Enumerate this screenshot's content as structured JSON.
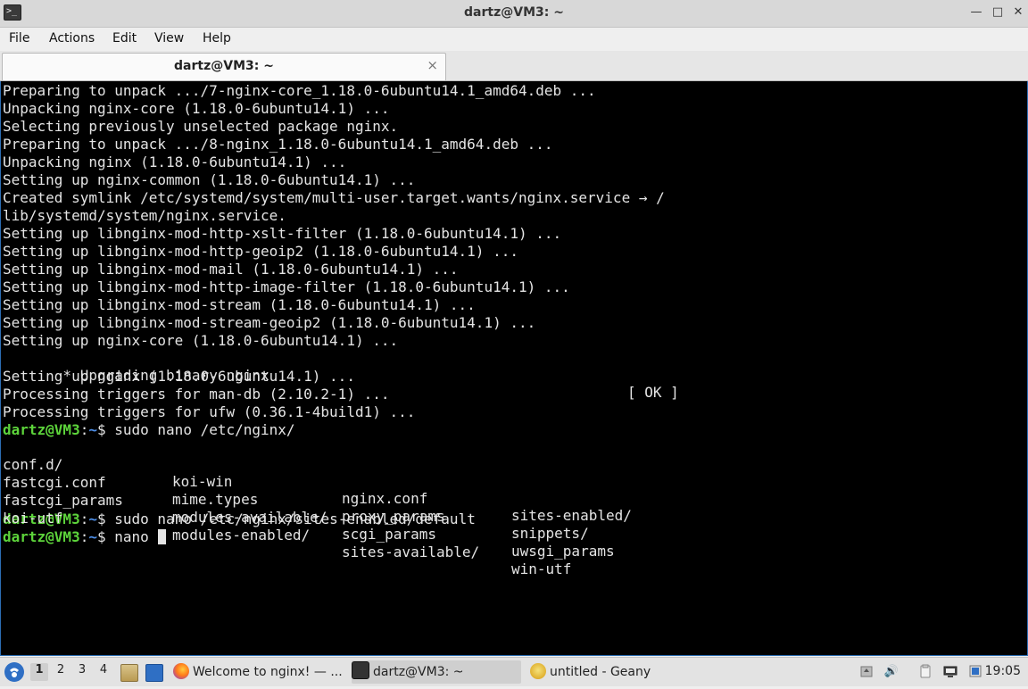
{
  "window": {
    "title": "dartz@VM3: ~",
    "terminal_glyph": ">_",
    "controls": {
      "minimize": "—",
      "maximize": "□",
      "close": "✕"
    }
  },
  "menubar": {
    "items": [
      "File",
      "Actions",
      "Edit",
      "View",
      "Help"
    ]
  },
  "tabs": [
    {
      "label": "dartz@VM3: ~",
      "close": "×"
    }
  ],
  "terminal": {
    "output_lines": [
      "Preparing to unpack .../7-nginx-core_1.18.0-6ubuntu14.1_amd64.deb ...",
      "Unpacking nginx-core (1.18.0-6ubuntu14.1) ...",
      "Selecting previously unselected package nginx.",
      "Preparing to unpack .../8-nginx_1.18.0-6ubuntu14.1_amd64.deb ...",
      "Unpacking nginx (1.18.0-6ubuntu14.1) ...",
      "Setting up nginx-common (1.18.0-6ubuntu14.1) ...",
      "Created symlink /etc/systemd/system/multi-user.target.wants/nginx.service → /",
      "lib/systemd/system/nginx.service.",
      "Setting up libnginx-mod-http-xslt-filter (1.18.0-6ubuntu14.1) ...",
      "Setting up libnginx-mod-http-geoip2 (1.18.0-6ubuntu14.1) ...",
      "Setting up libnginx-mod-mail (1.18.0-6ubuntu14.1) ...",
      "Setting up libnginx-mod-http-image-filter (1.18.0-6ubuntu14.1) ...",
      "Setting up libnginx-mod-stream (1.18.0-6ubuntu14.1) ...",
      "Setting up libnginx-mod-stream-geoip2 (1.18.0-6ubuntu14.1) ...",
      "Setting up nginx-core (1.18.0-6ubuntu14.1) ..."
    ],
    "upgrading_line": " * Upgrading binary nginx",
    "upgrading_status": "[ OK ]",
    "after_lines": [
      "Setting up nginx (1.18.0-6ubuntu14.1) ...",
      "Processing triggers for man-db (2.10.2-1) ...",
      "Processing triggers for ufw (0.36.1-4build1) ..."
    ],
    "prompt_user": "dartz@VM3",
    "prompt_sep": ":",
    "prompt_path": "~",
    "prompt_end": "$ ",
    "commands": [
      "sudo nano /etc/nginx/",
      "sudo nano /etc/nginx/sites-enabled/default",
      "nano "
    ],
    "completion_rows": [
      [
        "conf.d/",
        "koi-win",
        "nginx.conf",
        "sites-enabled/"
      ],
      [
        "fastcgi.conf",
        "mime.types",
        "proxy_params",
        "snippets/"
      ],
      [
        "fastcgi_params",
        "modules-available/",
        "scgi_params",
        "uwsgi_params"
      ],
      [
        "koi-utf",
        "modules-enabled/",
        "sites-available/",
        "win-utf"
      ]
    ]
  },
  "taskbar": {
    "start_icon": "start-menu-icon",
    "workspaces": [
      "1",
      "2",
      "3",
      "4"
    ],
    "active_workspace": "1",
    "tasks": [
      {
        "label": "Welcome to nginx! — ...",
        "icon": "firefox-icon",
        "active": false
      },
      {
        "label": "dartz@VM3: ~",
        "icon": "terminal-icon",
        "active": true
      },
      {
        "label": "untitled - Geany",
        "icon": "geany-icon",
        "active": false
      }
    ],
    "tray": {
      "volume_glyph": "🔊",
      "clock": "19:05"
    },
    "colors": {
      "prompt_user": "#5dd43b",
      "prompt_path": "#4e8fe8",
      "terminal_bg": "#000000"
    }
  }
}
